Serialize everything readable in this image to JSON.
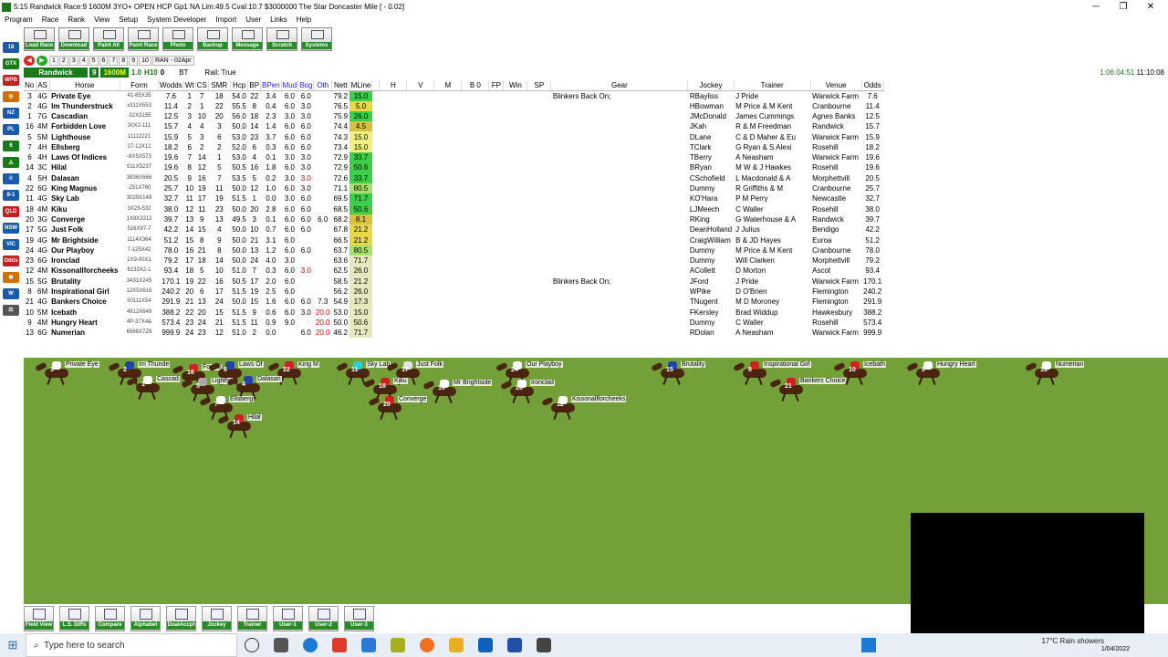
{
  "window": {
    "title": "5:15 Randwick Race:9 1600M 3YO+  OPEN HCP Gp1  NA Lim:49.5 Cval:10.7 $3000000 The Star Doncaster Mile [ - 0.02]",
    "minimize": "─",
    "restore": "❐",
    "close": "✕"
  },
  "menu": [
    "Program",
    "Race",
    "Rank",
    "View",
    "Setup",
    "System Developer",
    "Import",
    "User",
    "Links",
    "Help"
  ],
  "left_icons": [
    {
      "label": "18",
      "color": "#1a5aa8"
    },
    {
      "label": "GTX",
      "color": "#1a7a1a"
    },
    {
      "label": "WPB",
      "color": "#c02020"
    },
    {
      "label": "◎",
      "color": "#d07000"
    },
    {
      "label": "NZ",
      "color": "#1a5aa8"
    },
    {
      "label": "PL",
      "color": "#1a5aa8"
    },
    {
      "label": "6",
      "color": "#1a7a1a"
    },
    {
      "label": "◬",
      "color": "#1a7a1a"
    },
    {
      "label": "©",
      "color": "#1a5aa8"
    },
    {
      "label": "8-1",
      "color": "#1a5aa8"
    },
    {
      "label": "QLD",
      "color": "#c02020"
    },
    {
      "label": "NSW",
      "color": "#1a5aa8"
    },
    {
      "label": "VIC",
      "color": "#1a5aa8"
    },
    {
      "label": "Odds",
      "color": "#c02020"
    },
    {
      "label": "◉",
      "color": "#d07000"
    },
    {
      "label": "W",
      "color": "#1a5aa8"
    },
    {
      "label": "⚖",
      "color": "#555"
    }
  ],
  "toolbar": [
    "Load Race",
    "Download",
    "Paint All",
    "Paint Race",
    "Photo",
    "Backup",
    "Message",
    "Scratch",
    "Systems"
  ],
  "race_tabs": [
    "1",
    "2",
    "3",
    "4",
    "5",
    "6",
    "7",
    "8",
    "9",
    "10",
    "RAN - 02Apr"
  ],
  "info": {
    "venue": "Randwick",
    "race_no": "9",
    "distance": "1600M",
    "x1": "1.0",
    "x2": "H10",
    "x3": "0",
    "bt": "BT",
    "rail": "Rail: True"
  },
  "clock": {
    "elapsed": "1:06:04:51",
    "time": "11:10:08"
  },
  "columns": [
    "No",
    "AS",
    "Horse",
    "Form",
    "Wodds",
    "Wt",
    "CS",
    "SMR",
    "Hcp",
    "BP",
    "BPen",
    "Mud",
    "Bog",
    "Oth",
    "Nett",
    "MLine",
    "",
    "H",
    "V",
    "M",
    "B 0",
    "FP",
    "Win",
    "SP",
    "Gear",
    "Jockey",
    "Trainer",
    "Venue",
    "Odds"
  ],
  "rows": [
    {
      "no": "3",
      "as": "4G",
      "horse": "Private Eye",
      "form": "41-85X35",
      "wodds": "7.6",
      "wt": "1",
      "cs": "7",
      "smr": "18",
      "hcp": "54.0",
      "bp": "22",
      "bpen": "3.4",
      "mud": "6.0",
      "bog": "6.0",
      "oth": "",
      "nett": "79.2",
      "mline": "15.0",
      "mc": "#3ccf4a",
      "gear": "Blinkers Back On;",
      "jockey": "RBayliss",
      "trainer": "J Pride",
      "venue": "Warwick Farm",
      "odds": "7.6"
    },
    {
      "no": "2",
      "as": "4G",
      "horse": "Im Thunderstruck",
      "form": "x311X553",
      "wodds": "11.4",
      "wt": "2",
      "cs": "1",
      "smr": "22",
      "hcp": "55.5",
      "bp": "8",
      "bpen": "0.4",
      "mud": "6.0",
      "bog": "3.0",
      "oth": "",
      "nett": "76.5",
      "mline": "5.0",
      "mc": "#e8d848",
      "gear": "",
      "jockey": "HBowman",
      "trainer": "M Price & M Kent",
      "venue": "Cranbourne",
      "odds": "11.4"
    },
    {
      "no": "1",
      "as": "7G",
      "horse": "Cascadian",
      "form": "-32X3155",
      "wodds": "12.5",
      "wt": "3",
      "cs": "10",
      "smr": "20",
      "hcp": "56.0",
      "bp": "18",
      "bpen": "2.3",
      "mud": "3.0",
      "bog": "3.0",
      "oth": "",
      "nett": "75.9",
      "mline": "26.0",
      "mc": "#3ccf4a",
      "gear": "",
      "jockey": "JMcDonald",
      "trainer": "James Cummings",
      "venue": "Agnes Banks",
      "odds": "12.5"
    },
    {
      "no": "16",
      "as": "4M",
      "horse": "Forbidden Love",
      "form": "30X2-111",
      "wodds": "15.7",
      "wt": "4",
      "cs": "4",
      "smr": "3",
      "hcp": "50.0",
      "bp": "14",
      "bpen": "1.4",
      "mud": "6.0",
      "bog": "6.0",
      "oth": "",
      "nett": "74.4",
      "mline": "4.5",
      "mc": "#d8c040",
      "gear": "",
      "jockey": "JKah",
      "trainer": "R & M Freedman",
      "venue": "Randwick",
      "odds": "15.7"
    },
    {
      "no": "5",
      "as": "5M",
      "horse": "Lighthouse",
      "form": "11112221",
      "wodds": "15.9",
      "wt": "5",
      "cs": "3",
      "smr": "6",
      "hcp": "53.0",
      "bp": "23",
      "bpen": "3.7",
      "mud": "6.0",
      "bog": "6.0",
      "oth": "",
      "nett": "74.3",
      "mline": "15.0",
      "mc": "#f0f080",
      "gear": "",
      "jockey": "DLane",
      "trainer": "C & D Maher & Eu",
      "venue": "Warwick Farm",
      "odds": "15.9"
    },
    {
      "no": "7",
      "as": "4H",
      "horse": "Ellsberg",
      "form": "27-12X12",
      "wodds": "18.2",
      "wt": "6",
      "cs": "2",
      "smr": "2",
      "hcp": "52.0",
      "bp": "6",
      "bpen": "0.3",
      "mud": "6.0",
      "bog": "6.0",
      "oth": "",
      "nett": "73.4",
      "mline": "15.0",
      "mc": "#f0f080",
      "gear": "",
      "jockey": "TClark",
      "trainer": "G Ryan & S Alexi",
      "venue": "Rosehill",
      "odds": "18.2"
    },
    {
      "no": "6",
      "as": "4H",
      "horse": "Laws Of Indices",
      "form": "-8X5X573",
      "wodds": "19.6",
      "wt": "7",
      "cs": "14",
      "smr": "1",
      "hcp": "53.0",
      "bp": "4",
      "bpen": "0.1",
      "mud": "3.0",
      "bog": "3.0",
      "oth": "",
      "nett": "72.9",
      "mline": "33.7",
      "mc": "#3ccf4a",
      "gear": "",
      "jockey": "TBerry",
      "trainer": "A Neasham",
      "venue": "Warwick Farm",
      "odds": "19.6"
    },
    {
      "no": "14",
      "as": "3C",
      "horse": "Hilal",
      "form": "511X5237",
      "wodds": "19.6",
      "wt": "8",
      "cs": "12",
      "smr": "5",
      "hcp": "50.5",
      "bp": "16",
      "bpen": "1.8",
      "mud": "6.0",
      "bog": "3.0",
      "oth": "",
      "nett": "72.9",
      "mline": "50.6",
      "mc": "#3ccf4a",
      "gear": "",
      "jockey": "BRyan",
      "trainer": "M W & J Hawkes",
      "venue": "Rosehill",
      "odds": "19.6"
    },
    {
      "no": "4",
      "as": "5H",
      "horse": "Dalasan",
      "form": "3836X666",
      "wodds": "20.5",
      "wt": "9",
      "cs": "16",
      "smr": "7",
      "hcp": "53.5",
      "bp": "5",
      "bpen": "0.2",
      "mud": "3.0",
      "bog": "3.0",
      "oth": "",
      "nett": "72.6",
      "mline": "33.7",
      "mc": "#3ccf4a",
      "bogred": true,
      "gear": "",
      "jockey": "CSchofield",
      "trainer": "L Macdonald & A",
      "venue": "Morphettvill",
      "odds": "20.5"
    },
    {
      "no": "22",
      "as": "6G",
      "horse": "King Magnus",
      "form": "-251X760",
      "wodds": "25.7",
      "wt": "10",
      "cs": "19",
      "smr": "11",
      "hcp": "50.0",
      "bp": "12",
      "bpen": "1.0",
      "mud": "6.0",
      "bog": "3.0",
      "oth": "",
      "nett": "71.1",
      "mline": "80.5",
      "mc": "#a8e070",
      "gear": "",
      "jockey": "Dummy",
      "trainer": "R Griffiths & M",
      "venue": "Cranbourne",
      "odds": "25.7"
    },
    {
      "no": "11",
      "as": "4G",
      "horse": "Sky Lab",
      "form": "3029X149",
      "wodds": "32.7",
      "wt": "11",
      "cs": "17",
      "smr": "19",
      "hcp": "51.5",
      "bp": "1",
      "bpen": "0.0",
      "mud": "3.0",
      "bog": "6.0",
      "oth": "",
      "nett": "69.5",
      "mline": "71.7",
      "mc": "#3ccf4a",
      "gear": "",
      "jockey": "KO'Hara",
      "trainer": "P M Perry",
      "venue": "Newcastle",
      "odds": "32.7"
    },
    {
      "no": "18",
      "as": "4M",
      "horse": "Kiku",
      "form": "3X23-532",
      "wodds": "38.0",
      "wt": "12",
      "cs": "11",
      "smr": "23",
      "hcp": "50.0",
      "bp": "20",
      "bpen": "2.8",
      "mud": "6.0",
      "bog": "6.0",
      "oth": "",
      "nett": "68.5",
      "mline": "50.6",
      "mc": "#3ccf4a",
      "gear": "",
      "jockey": "LJMeech",
      "trainer": "C Waller",
      "venue": "Rosehill",
      "odds": "38.0"
    },
    {
      "no": "20",
      "as": "3G",
      "horse": "Converge",
      "form": "1X8X3312",
      "wodds": "39.7",
      "wt": "13",
      "cs": "9",
      "smr": "13",
      "hcp": "49.5",
      "bp": "3",
      "bpen": "0.1",
      "mud": "6.0",
      "bog": "6.0",
      "oth": "6.0",
      "nett": "68.2",
      "mline": "8.1",
      "mc": "#d8c040",
      "gear": "",
      "jockey": "RKing",
      "trainer": "G Waterhouse & A",
      "venue": "Randwick",
      "odds": "39.7"
    },
    {
      "no": "17",
      "as": "5G",
      "horse": "Just Folk",
      "form": "516X97-7",
      "wodds": "42.2",
      "wt": "14",
      "cs": "15",
      "smr": "4",
      "hcp": "50.0",
      "bp": "10",
      "bpen": "0.7",
      "mud": "6.0",
      "bog": "6.0",
      "oth": "",
      "nett": "67.8",
      "mline": "21.2",
      "mc": "#e8d848",
      "gear": "",
      "jockey": "DeanHolland",
      "trainer": "J Julius",
      "venue": "Bendigo",
      "odds": "42.2"
    },
    {
      "no": "19",
      "as": "4G",
      "horse": "Mr Brightside",
      "form": "1114X364",
      "wodds": "51.2",
      "wt": "15",
      "cs": "8",
      "smr": "9",
      "hcp": "50.0",
      "bp": "21",
      "bpen": "3.1",
      "mud": "6.0",
      "bog": "",
      "oth": "",
      "nett": "66.5",
      "mline": "21.2",
      "mc": "#e8d848",
      "gear": "",
      "jockey": "CraigWilliam",
      "trainer": "B & JD Hayes",
      "venue": "Euroa",
      "odds": "51.2"
    },
    {
      "no": "24",
      "as": "4G",
      "horse": "Our Playboy",
      "form": "7-125X42",
      "wodds": "78.0",
      "wt": "16",
      "cs": "21",
      "smr": "8",
      "hcp": "50.0",
      "bp": "13",
      "bpen": "1.2",
      "mud": "6.0",
      "bog": "6.0",
      "oth": "",
      "nett": "63.7",
      "mline": "80.5",
      "mc": "#a8e070",
      "gear": "",
      "jockey": "Dummy",
      "trainer": "M Price & M Kent",
      "venue": "Cranbourne",
      "odds": "78.0"
    },
    {
      "no": "23",
      "as": "6G",
      "horse": "Ironclad",
      "form": "1X9-00X1",
      "wodds": "79.2",
      "wt": "17",
      "cs": "18",
      "smr": "14",
      "hcp": "50.0",
      "bp": "24",
      "bpen": "4.0",
      "mud": "3.0",
      "bog": "",
      "oth": "",
      "nett": "63.6",
      "mline": "71.7",
      "mc": "#e8e8c0",
      "gear": "",
      "jockey": "Dummy",
      "trainer": "Will Clarken",
      "venue": "Morphettvill",
      "odds": "79.2"
    },
    {
      "no": "12",
      "as": "4M",
      "horse": "Kissonallforcheeks",
      "form": "6133X2-1",
      "wodds": "93.4",
      "wt": "18",
      "cs": "5",
      "smr": "10",
      "hcp": "51.0",
      "bp": "7",
      "bpen": "0.3",
      "mud": "6.0",
      "bog": "3.0",
      "oth": "",
      "nett": "62.5",
      "mline": "26.0",
      "mc": "#e8e8c0",
      "bogred": true,
      "gear": "",
      "jockey": "ACollett",
      "trainer": "D Morton",
      "venue": "Ascot",
      "odds": "93.4"
    },
    {
      "no": "15",
      "as": "5G",
      "horse": "Brutality",
      "form": "3431X245",
      "wodds": "170.1",
      "wt": "19",
      "cs": "22",
      "smr": "16",
      "hcp": "50.5",
      "bp": "17",
      "bpen": "2.0",
      "mud": "6.0",
      "bog": "",
      "oth": "",
      "nett": "58.5",
      "mline": "21.2",
      "mc": "#e8e8c0",
      "gear": "Blinkers Back On;",
      "jockey": "JFord",
      "trainer": "J Pride",
      "venue": "Warwick Farm",
      "odds": "170.1"
    },
    {
      "no": "8",
      "as": "6M",
      "horse": "Inspirational Girl",
      "form": "12X5X616",
      "wodds": "240.2",
      "wt": "20",
      "cs": "6",
      "smr": "17",
      "hcp": "51.5",
      "bp": "19",
      "bpen": "2.5",
      "mud": "6.0",
      "bog": "",
      "oth": "",
      "nett": "56.2",
      "mline": "26.0",
      "mc": "#e8e8c0",
      "gear": "",
      "jockey": "WPike",
      "trainer": "D O'Brien",
      "venue": "Flemington",
      "odds": "240.2"
    },
    {
      "no": "21",
      "as": "4G",
      "horse": "Bankers Choice",
      "form": "50111X54",
      "wodds": "291.9",
      "wt": "21",
      "cs": "13",
      "smr": "24",
      "hcp": "50.0",
      "bp": "15",
      "bpen": "1.6",
      "mud": "6.0",
      "bog": "6.0",
      "oth": "7.3",
      "nett": "54.9",
      "mline": "17.3",
      "mc": "#e8e8c0",
      "othred": false,
      "gear": "",
      "jockey": "TNugent",
      "trainer": "M D Moroney",
      "venue": "Flemington",
      "odds": "291.9"
    },
    {
      "no": "10",
      "as": "5M",
      "horse": "Icebath",
      "form": "4912X649",
      "wodds": "388.2",
      "wt": "22",
      "cs": "20",
      "smr": "15",
      "hcp": "51.5",
      "bp": "9",
      "bpen": "0.6",
      "mud": "6.0",
      "bog": "3.0",
      "oth": "20.0",
      "nett": "53.0",
      "mline": "15.0",
      "mc": "#e8e8c0",
      "othred": true,
      "gear": "",
      "jockey": "FKersley",
      "trainer": "Brad Widdup",
      "venue": "Hawkesbury",
      "odds": "388.2"
    },
    {
      "no": "9",
      "as": "4M",
      "horse": "Hungry Heart",
      "form": "4P-37X4&",
      "wodds": "573.4",
      "wt": "23",
      "cs": "24",
      "smr": "21",
      "hcp": "51.5",
      "bp": "11",
      "bpen": "0.9",
      "mud": "9.0",
      "bog": "",
      "oth": "20.0",
      "nett": "50.0",
      "mline": "50.6",
      "mc": "#e8e8c0",
      "othred": true,
      "gear": "",
      "jockey": "Dummy",
      "trainer": "C Waller",
      "venue": "Rosehill",
      "odds": "573.4"
    },
    {
      "no": "13",
      "as": "6G",
      "horse": "Numerian",
      "form": "6568X7Z6",
      "wodds": "999.9",
      "wt": "24",
      "cs": "23",
      "smr": "12",
      "hcp": "51.0",
      "bp": "2",
      "bpen": "0.0",
      "mud": "",
      "bog": "6.0",
      "oth": "20.0",
      "nett": "46.2",
      "mline": "71.7",
      "mc": "#e8e8c0",
      "othred": true,
      "gear": "",
      "jockey": "RDolan",
      "trainer": "A Neasham",
      "venue": "Warwick Farm",
      "odds": "999.9"
    }
  ],
  "track_horses": [
    {
      "num": "3",
      "name": "Private Eye",
      "c": "#fff"
    },
    {
      "num": "2",
      "name": "Im Thunde",
      "c": "#2244aa"
    },
    {
      "num": "16",
      "name": "Forbid",
      "c": "#c22"
    },
    {
      "num": "6",
      "name": "Laws Of",
      "c": "#2244aa"
    },
    {
      "num": "22",
      "name": "King M",
      "c": "#c22"
    },
    {
      "num": "11",
      "name": "Sky Lab",
      "c": "#3cc"
    },
    {
      "num": "17",
      "name": "Just Folk",
      "c": "#e2e2e2"
    },
    {
      "num": "1",
      "name": "Cascad",
      "c": "#fff"
    },
    {
      "num": "5",
      "name": "Lightho",
      "c": "#aaa"
    },
    {
      "num": "4",
      "name": "Dalasan",
      "c": "#2244aa"
    },
    {
      "num": "18",
      "name": "Kiku",
      "c": "#c22"
    },
    {
      "num": "19",
      "name": "Mr Brightside",
      "c": "#fff"
    },
    {
      "num": "24",
      "name": "Our Playboy",
      "c": "#f4f4f4"
    },
    {
      "num": "23",
      "name": "Ironclad",
      "c": "#fff"
    },
    {
      "num": "7",
      "name": "Ellsberg",
      "c": "#fff"
    },
    {
      "num": "20",
      "name": "Converge",
      "c": "#c22"
    },
    {
      "num": "12",
      "name": "Kissonallforcheeks",
      "c": "#fff"
    },
    {
      "num": "14",
      "name": "Hilal",
      "c": "#c22"
    },
    {
      "num": "15",
      "name": "Brutality",
      "c": "#2244aa"
    },
    {
      "num": "8",
      "name": "Inspirational Girl",
      "c": "#c22"
    },
    {
      "num": "21",
      "name": "Bankers Choice",
      "c": "#c22"
    },
    {
      "num": "10",
      "name": "Icebath",
      "c": "#c22"
    },
    {
      "num": "9",
      "name": "Hungry Heart",
      "c": "#fff"
    },
    {
      "num": "13",
      "name": "Numerian",
      "c": "#fff"
    }
  ],
  "bottom_buttons": [
    "Field View",
    "L.S. Diffs",
    "Compare",
    "Alphabet",
    "DualAccpt",
    "Jockey",
    "Trainer",
    "User-1",
    "User-2",
    "User-3"
  ],
  "taskbar": {
    "search_placeholder": "Type here to search",
    "weather": "17°C  Rain showers",
    "date": "1/04/2022"
  }
}
